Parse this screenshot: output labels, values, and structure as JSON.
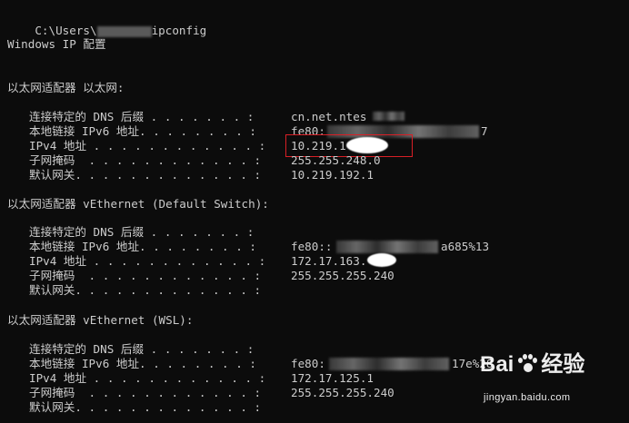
{
  "command_prompt": {
    "command_line": {
      "prefix": "C:\\Users\\",
      "command": "ipconfig"
    },
    "header": "Windows IP 配置",
    "adapters": [
      {
        "title": "以太网适配器 以太网:",
        "rows": [
          {
            "label": "连接特定的 DNS 后缀 . . . . . . . :",
            "value": "cn.net.ntes"
          },
          {
            "label": "本地链接 IPv6 地址. . . . . . . . :",
            "value": "fe80:",
            "suffix": "7"
          },
          {
            "label": "IPv4 地址 . . . . . . . . . . . . :",
            "value": "10.219.1"
          },
          {
            "label": "子网掩码  . . . . . . . . . . . . :",
            "value": "255.255.248.0"
          },
          {
            "label": "默认网关. . . . . . . . . . . . . :",
            "value": "10.219.192.1"
          }
        ]
      },
      {
        "title": "以太网适配器 vEthernet (Default Switch):",
        "rows": [
          {
            "label": "连接特定的 DNS 后缀 . . . . . . . :",
            "value": ""
          },
          {
            "label": "本地链接 IPv6 地址. . . . . . . . :",
            "value": "fe80::",
            "suffix": "a685%13"
          },
          {
            "label": "IPv4 地址 . . . . . . . . . . . . :",
            "value": "172.17.163."
          },
          {
            "label": "子网掩码  . . . . . . . . . . . . :",
            "value": "255.255.255.240"
          },
          {
            "label": "默认网关. . . . . . . . . . . . . :",
            "value": ""
          }
        ]
      },
      {
        "title": "以太网适配器 vEthernet (WSL):",
        "rows": [
          {
            "label": "连接特定的 DNS 后缀 . . . . . . . :",
            "value": ""
          },
          {
            "label": "本地链接 IPv6 地址. . . . . . . . :",
            "value": "fe80:",
            "suffix": "17e%28"
          },
          {
            "label": "IPv4 地址 . . . . . . . . . . . . :",
            "value": "172.17.125.1"
          },
          {
            "label": "子网掩码  . . . . . . . . . . . . :",
            "value": "255.255.255.240"
          },
          {
            "label": "默认网关. . . . . . . . . . . . . :",
            "value": ""
          }
        ]
      }
    ]
  },
  "watermark": {
    "brand": "Bai",
    "brand_tail": "经验",
    "site": "jingyan.baidu.com"
  },
  "colors": {
    "console_bg": "#0c0c0c",
    "console_text": "#cccccc",
    "highlight": "#d81f26"
  }
}
